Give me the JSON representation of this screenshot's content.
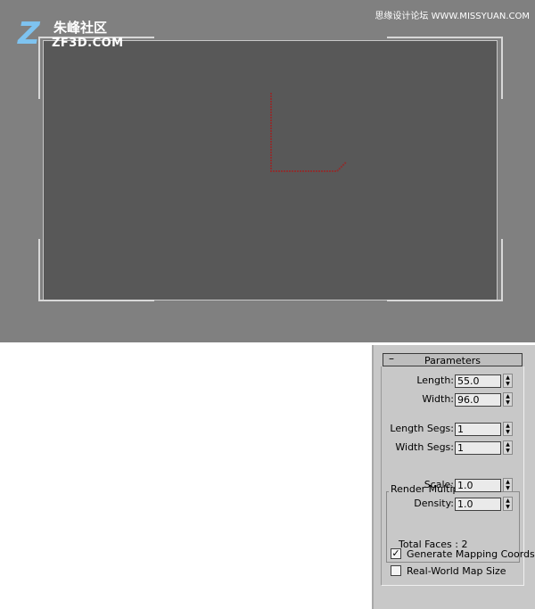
{
  "watermark": {
    "logo_letter": "Z",
    "logo_cn": "朱峰社区",
    "logo_en": "ZF3D.COM",
    "site": "思缘设计论坛 WWW.MISSYUAN.COM"
  },
  "viewport": {
    "background_color": "#808080",
    "safe_frame_color": "#585858",
    "gizmo_color": "#8a3030"
  },
  "rollout": {
    "collapse_symbol": "–",
    "title": "Parameters",
    "length_label": "Length:",
    "length_value": "55.0",
    "width_label": "Width:",
    "width_value": "96.0",
    "length_segs_label": "Length Segs:",
    "length_segs_value": "1",
    "width_segs_label": "Width Segs:",
    "width_segs_value": "1",
    "render_group_title": "Render Multipliers",
    "scale_label": "Scale:",
    "scale_value": "1.0",
    "density_label": "Density:",
    "density_value": "1.0",
    "total_faces": "Total Faces : 2",
    "gen_mapping_label": "Generate Mapping Coords.",
    "gen_mapping_checked": "✓",
    "real_world_label": "Real-World Map Size",
    "real_world_checked": ""
  }
}
